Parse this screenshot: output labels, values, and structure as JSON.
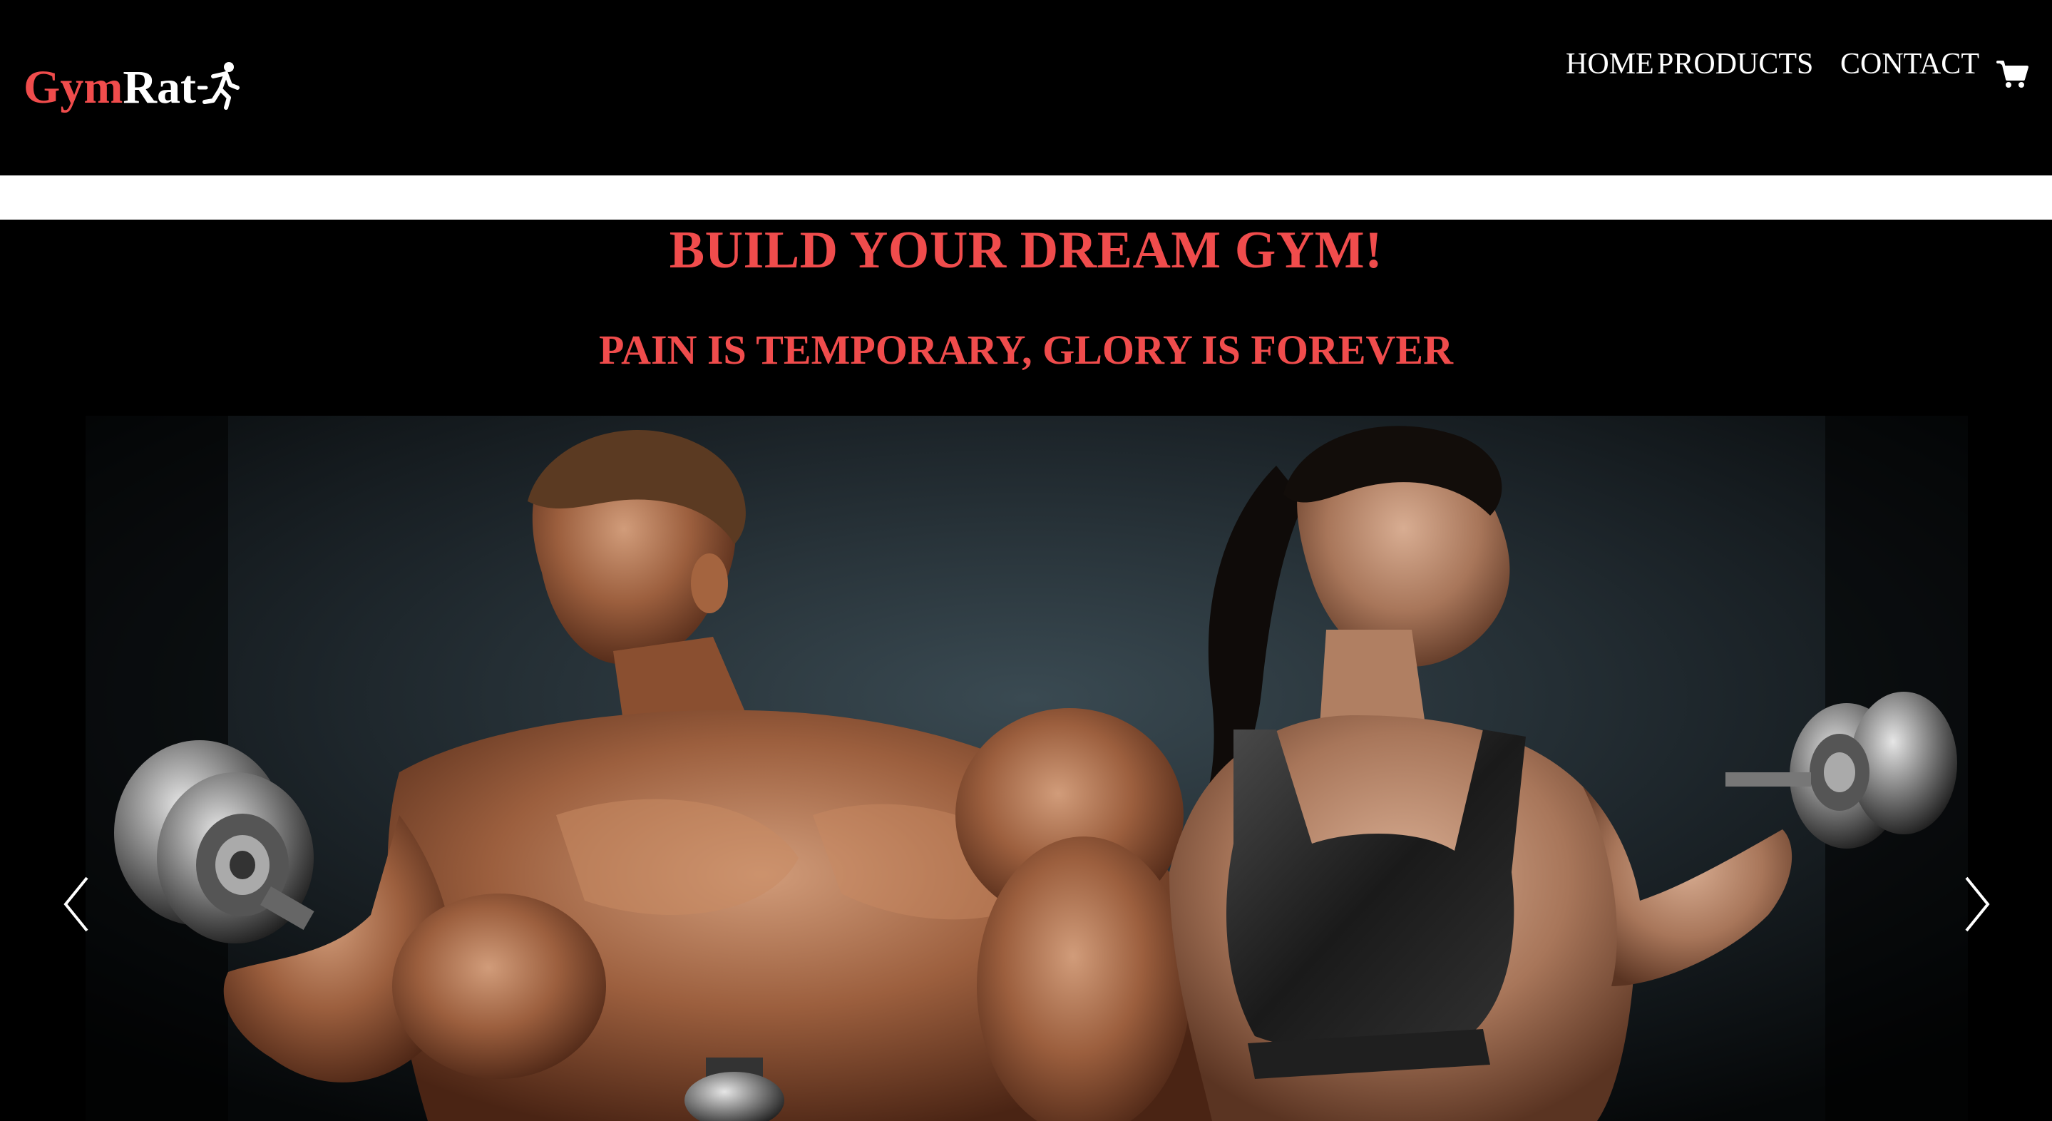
{
  "brand": {
    "part1": "Gym",
    "part2": "Rat",
    "icon": "running-person-icon"
  },
  "nav": {
    "items": [
      {
        "label": "HOME"
      },
      {
        "label": "PRODUCTS"
      },
      {
        "label": "CONTACT"
      }
    ],
    "cart_icon": "shopping-cart-icon"
  },
  "hero": {
    "title": "BUILD YOUR DREAM GYM!",
    "subtitle": "PAIN IS TEMPORARY, GLORY IS FOREVER"
  },
  "carousel": {
    "prev_icon": "chevron-left-icon",
    "next_icon": "chevron-right-icon",
    "slide_image": "man-and-woman-holding-dumbbells-photo"
  },
  "colors": {
    "accent": "#f04c4c",
    "background": "#000000",
    "nav_text": "#ffffff"
  }
}
